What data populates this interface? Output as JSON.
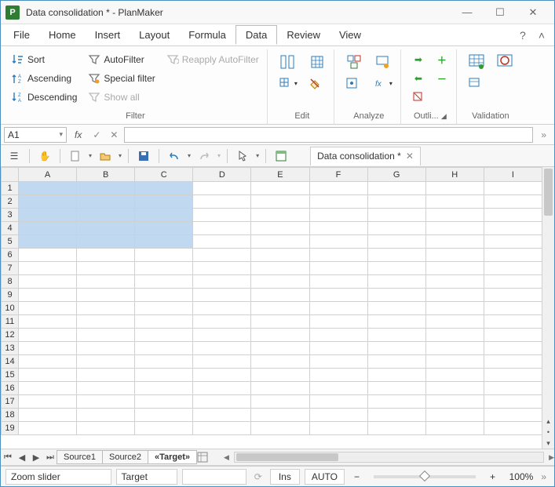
{
  "window": {
    "title": "Data consolidation * - PlanMaker",
    "app_letter": "P"
  },
  "menu": {
    "items": [
      "File",
      "Home",
      "Insert",
      "Layout",
      "Formula",
      "Data",
      "Review",
      "View"
    ],
    "active_index": 5
  },
  "ribbon": {
    "filter": {
      "sort": "Sort",
      "ascending": "Ascending",
      "descending": "Descending",
      "autofilter": "AutoFilter",
      "special": "Special filter",
      "reapply": "Reapply AutoFilter",
      "showall": "Show all",
      "group_label": "Filter"
    },
    "edit": {
      "group_label": "Edit"
    },
    "analyze": {
      "group_label": "Analyze"
    },
    "outline": {
      "group_label": "Outli..."
    },
    "validation": {
      "group_label": "Validation"
    }
  },
  "formula_bar": {
    "cell_ref": "A1",
    "fx_label": "fx",
    "formula": ""
  },
  "doc_tab": {
    "label": "Data consolidation *"
  },
  "columns": [
    "A",
    "B",
    "C",
    "D",
    "E",
    "F",
    "G",
    "H",
    "I"
  ],
  "rows": [
    1,
    2,
    3,
    4,
    5,
    6,
    7,
    8,
    9,
    10,
    11,
    12,
    13,
    14,
    15,
    16,
    17,
    18,
    19
  ],
  "selection": {
    "rows": [
      1,
      2,
      3,
      4,
      5
    ],
    "cols": [
      "A",
      "B",
      "C"
    ]
  },
  "sheet_tabs": {
    "tabs": [
      "Source1",
      "Source2",
      "«Target»"
    ],
    "active_index": 2
  },
  "status": {
    "zoom_label": "Zoom slider",
    "sheet_name": "Target",
    "ins": "Ins",
    "auto": "AUTO",
    "zoom_pct": "100%"
  }
}
